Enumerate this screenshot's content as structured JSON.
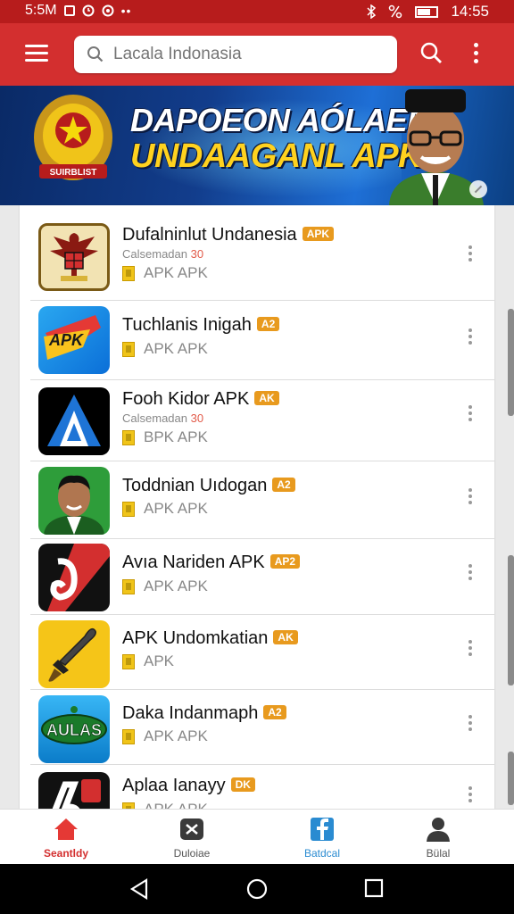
{
  "status_bar": {
    "left_text": "5:5M",
    "time": "14:55"
  },
  "toolbar": {
    "search_placeholder": "Lacala Indonasia",
    "accent_color": "#d32f2f"
  },
  "banner": {
    "line1": "DAPOEON AÓLAEN",
    "line2": "UNDAAGANL APK",
    "emblem_text": "SUIRBLIST"
  },
  "apps": [
    {
      "name": "Dufalninlut Undanesia",
      "badge": "APK",
      "subtitle": "Calsemadan",
      "subtitle_mark": "30",
      "meta": "APK APK",
      "icon": "garuda-icon"
    },
    {
      "name": "Tuchlanis Inigah",
      "badge": "A2",
      "subtitle": "",
      "subtitle_mark": "",
      "meta": "APK APK",
      "icon": "apk-arrow-icon"
    },
    {
      "name": "Fooh Kidor APK",
      "badge": "AK",
      "subtitle": "Calsemadan",
      "subtitle_mark": "30",
      "meta": "BPK APK",
      "icon": "blue-a-icon"
    },
    {
      "name": "Toddnian Uıdogan",
      "badge": "A2",
      "subtitle": "",
      "subtitle_mark": "",
      "meta": "APK APK",
      "icon": "person-icon"
    },
    {
      "name": "Avıa Nariden APK",
      "badge": "AP2",
      "subtitle": "",
      "subtitle_mark": "",
      "meta": "APK APK",
      "icon": "red-stripe-icon"
    },
    {
      "name": "APK Undomkatian",
      "badge": "AK",
      "subtitle": "",
      "subtitle_mark": "",
      "meta": "APK",
      "icon": "kris-dagger-icon"
    },
    {
      "name": "Daka Indanmaph",
      "badge": "A2",
      "subtitle": "",
      "subtitle_mark": "",
      "meta": "APK APK",
      "icon": "atlas-icon"
    },
    {
      "name": "Aplaa Ianayy",
      "badge": "DK",
      "subtitle": "",
      "subtitle_mark": "",
      "meta": "APK APK",
      "icon": "black-logo-icon"
    }
  ],
  "icons_text": {
    "apk_label": "APK",
    "atlas_label": "AULAS"
  },
  "bottom_nav": [
    {
      "label": "Seantldy",
      "icon": "home-icon",
      "color": "#d32f2f"
    },
    {
      "label": "Duloiae",
      "icon": "close-box-icon",
      "color": "#555555"
    },
    {
      "label": "Batdcal",
      "icon": "facebook-icon",
      "color": "#2a8bd1"
    },
    {
      "label": "Bülal",
      "icon": "profile-icon",
      "color": "#555555"
    }
  ]
}
